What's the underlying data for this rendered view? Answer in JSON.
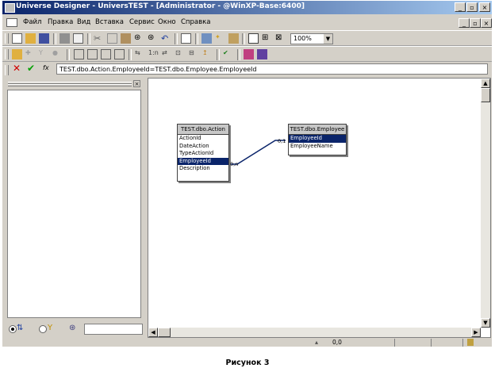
{
  "window": {
    "title": "Universe Designer - UniversTEST - [Administrator - @WinXP-Base:6400]"
  },
  "menu": {
    "items": [
      "Файл",
      "Правка",
      "Вид",
      "Вставка",
      "Сервис",
      "Окно",
      "Справка"
    ]
  },
  "toolbar": {
    "zoom": "100%"
  },
  "formula": {
    "cancel_icon": "cancel-x-icon",
    "accept_icon": "check-icon",
    "fx_label": "fx",
    "expression": "TEST.dbo.Action.EmployeeId=TEST.dbo.Employee.EmployeeId"
  },
  "tables": [
    {
      "name": "TEST.dbo.Action",
      "columns": [
        "ActionId",
        "DateAction",
        "TypeActionId",
        "EmployeeId",
        "Description"
      ],
      "selected": "EmployeeId"
    },
    {
      "name": "TEST.dbo.Employee",
      "columns": [
        "EmployeeId",
        "EmployeeName"
      ],
      "selected": "EmployeeId"
    }
  ],
  "join": {
    "left_cardinality": "0,n",
    "right_cardinality": "0,1",
    "color": "#0a246a"
  },
  "statusbar": {
    "coords": "0,0"
  },
  "caption": "Рисунок 3"
}
